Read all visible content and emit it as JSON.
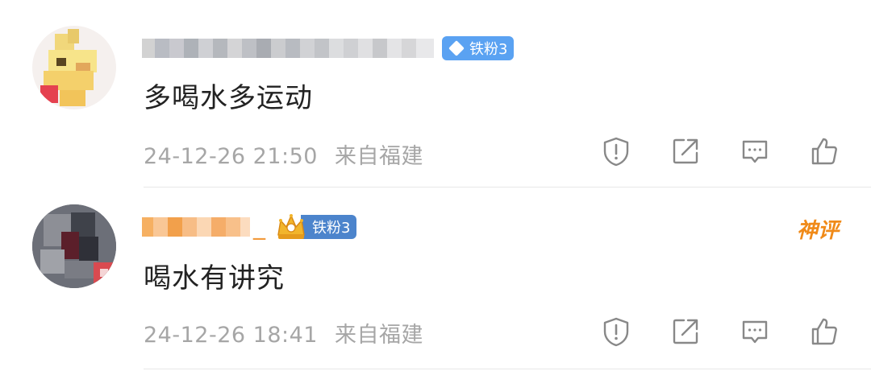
{
  "comments": [
    {
      "badge": "铁粉3",
      "text": "多喝水多运动",
      "time": "24-12-26 21:50",
      "location": "来自福建"
    },
    {
      "name_suffix": "_",
      "badge": "铁粉3",
      "tag": "神评",
      "text": "喝水有讲究",
      "time": "24-12-26 18:41",
      "location": "来自福建"
    }
  ],
  "actions": [
    "report-icon",
    "share-icon",
    "comment-icon",
    "like-icon"
  ],
  "colors": {
    "badge_blue": "#5aa2f2",
    "badge_dark": "#4c84cc",
    "text": "#222222",
    "meta": "#a6a6a6",
    "god_tag": "#f08a18"
  }
}
